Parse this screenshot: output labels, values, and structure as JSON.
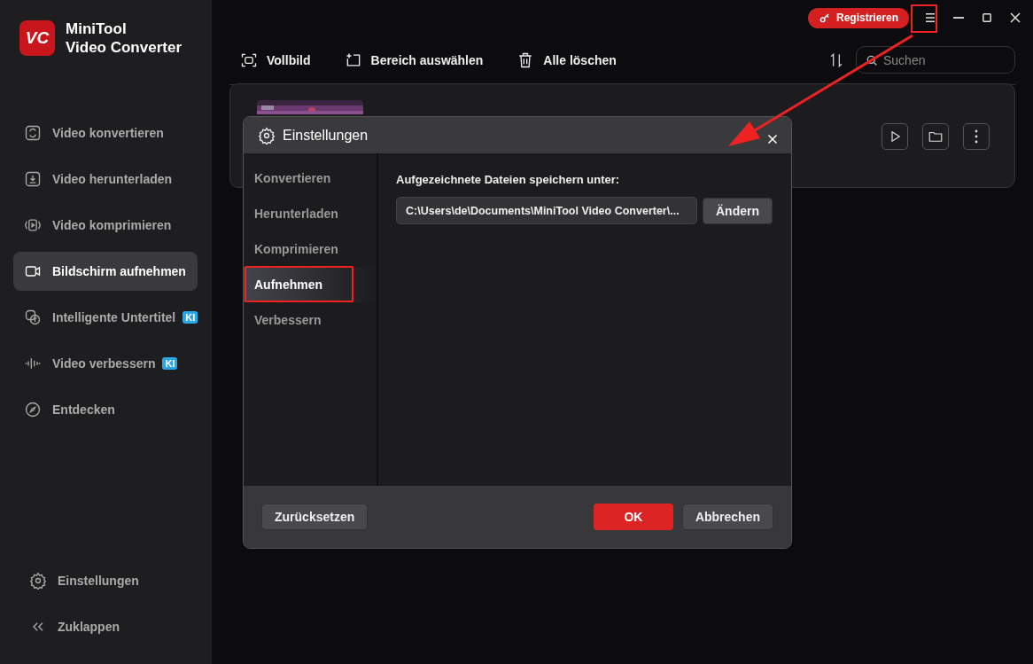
{
  "app": {
    "name_line1": "MiniTool",
    "name_line2": "Video Converter",
    "logo": "VC"
  },
  "sidebar": {
    "items": [
      {
        "label": "Video konvertieren",
        "selected": false
      },
      {
        "label": "Video herunterladen",
        "selected": false
      },
      {
        "label": "Video komprimieren",
        "selected": false
      },
      {
        "label": "Bildschirm aufnehmen",
        "selected": true
      },
      {
        "label": "Intelligente Untertitel",
        "selected": false,
        "badge": "KI"
      },
      {
        "label": "Video verbessern",
        "selected": false,
        "badge": "KI"
      },
      {
        "label": "Entdecken",
        "selected": false
      }
    ],
    "bottom": [
      {
        "label": "Einstellungen"
      },
      {
        "label": "Zuklappen"
      }
    ]
  },
  "titlebar": {
    "register": "Registrieren"
  },
  "toolbar": {
    "buttons": [
      {
        "label": "Vollbild"
      },
      {
        "label": "Bereich auswählen"
      },
      {
        "label": "Alle löschen"
      }
    ],
    "search": {
      "placeholder": "Suchen"
    }
  },
  "dialog": {
    "title": "Einstellungen",
    "tabs": [
      {
        "label": "Konvertieren",
        "selected": false
      },
      {
        "label": "Herunterladen",
        "selected": false
      },
      {
        "label": "Komprimieren",
        "selected": false
      },
      {
        "label": "Aufnehmen",
        "selected": true
      },
      {
        "label": "Verbessern",
        "selected": false
      }
    ],
    "save_label": "Aufgezeichnete Dateien speichern unter:",
    "path": "C:\\Users\\de\\Documents\\MiniTool Video Converter\\...",
    "change": "Ändern",
    "reset": "Zurücksetzen",
    "ok": "OK",
    "cancel": "Abbrechen"
  }
}
